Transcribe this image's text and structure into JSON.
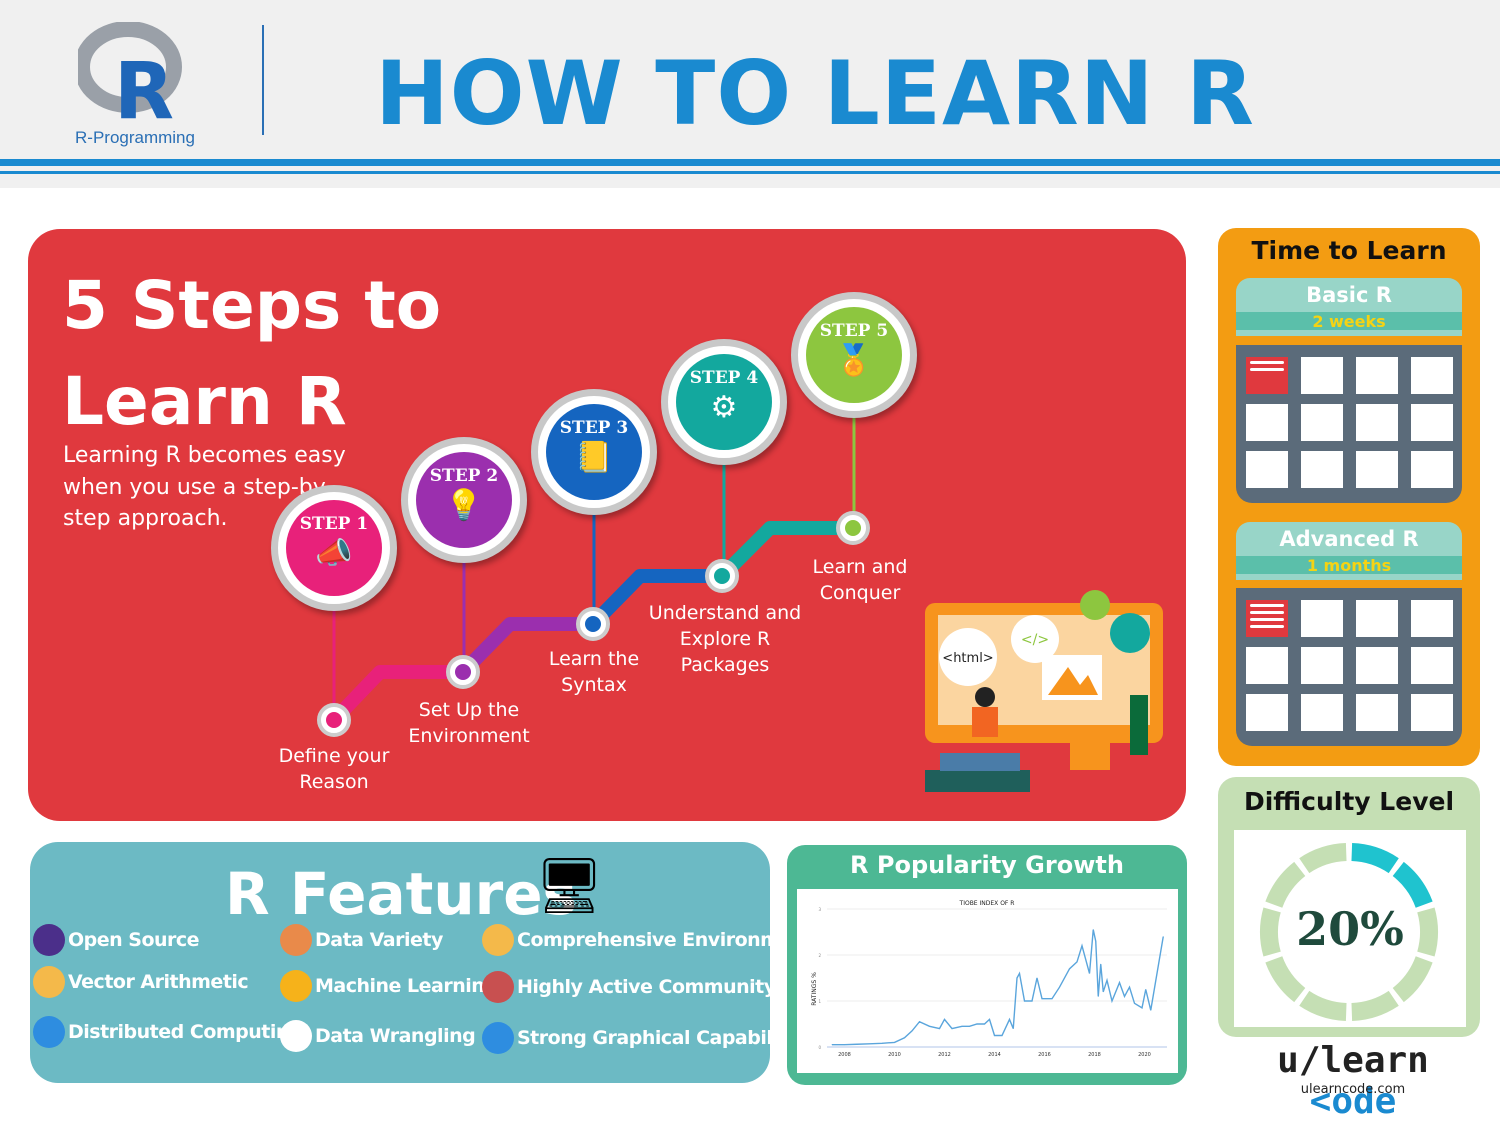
{
  "header": {
    "logo_letter": "R",
    "logo_text": "R-Programming",
    "title": "HOW TO LEARN R"
  },
  "steps_panel": {
    "title": "5 Steps to Learn R",
    "intro": "Learning R becomes easy when you use a step-by-step approach.",
    "steps": [
      {
        "badge": "STEP 1",
        "label": "Define your Reason",
        "color": "#e8217a",
        "icon": "megaphone-person-icon"
      },
      {
        "badge": "STEP 2",
        "label": "Set Up the Environment",
        "color": "#9b2fae",
        "icon": "lightbulb-icon"
      },
      {
        "badge": "STEP 3",
        "label": "Learn the Syntax",
        "color": "#1565c0",
        "icon": "book-icon"
      },
      {
        "badge": "STEP 4",
        "label": "Understand and Explore R Packages",
        "color": "#13a89e",
        "icon": "gear-magnifier-icon"
      },
      {
        "badge": "STEP 5",
        "label": "Learn and Conquer",
        "color": "#8dc63f",
        "icon": "medal-icon"
      }
    ],
    "illustration": {
      "tag1": "<html>",
      "tag2": "</>"
    }
  },
  "time_to_learn": {
    "title": "Time to Learn",
    "items": [
      {
        "name": "Basic R",
        "duration": "2 weeks"
      },
      {
        "name": "Advanced R",
        "duration": "1 months"
      }
    ]
  },
  "difficulty": {
    "title": "Difficulty Level",
    "value_label": "20%",
    "value": 20,
    "colors": {
      "filled": "#1fc3cf",
      "empty": "#c5dfb4"
    }
  },
  "features": {
    "title": "R Features",
    "items": [
      {
        "label": "Open Source",
        "icon": "open-source-icon",
        "color": "#4b2f8a"
      },
      {
        "label": "Data Variety",
        "icon": "data-variety-icon",
        "color": "#e98a4a"
      },
      {
        "label": "Comprehensive Environment",
        "icon": "shield-check-icon",
        "color": "#f4b94a"
      },
      {
        "label": "Vector Arithmetic",
        "icon": "scale-icon",
        "color": "#f4b94a"
      },
      {
        "label": "Machine Learning",
        "icon": "computer-icon",
        "color": "#f6b21a"
      },
      {
        "label": "Highly Active Community",
        "icon": "thumbs-up-icon",
        "color": "#c85050"
      },
      {
        "label": "Distributed Computing",
        "icon": "mobile-icon",
        "color": "#2e8de0"
      },
      {
        "label": "Data Wrangling",
        "icon": "hand-truck-icon",
        "color": "#ffffff"
      },
      {
        "label": "Strong Graphical Capabilities",
        "icon": "bar-chart-icon",
        "color": "#2e8de0"
      }
    ]
  },
  "popularity": {
    "title": "R Popularity Growth"
  },
  "chart_data": {
    "type": "line",
    "title": "TIOBE INDEX OF R",
    "xlabel": "",
    "ylabel": "RATINGS %",
    "xlim": [
      2007.3,
      2020.9
    ],
    "ylim": [
      0,
      3
    ],
    "xticks": [
      "2008",
      "2010",
      "2012",
      "2014",
      "2016",
      "2018",
      "2020"
    ],
    "yticks": [
      "0",
      "1",
      "2",
      "3"
    ],
    "grid": "horizontal",
    "color": "#5aa5dc",
    "x": [
      2007.5,
      2008,
      2008.5,
      2009,
      2009.5,
      2010,
      2010.4,
      2010.7,
      2011,
      2011.4,
      2011.8,
      2012,
      2012.3,
      2012.7,
      2013,
      2013.3,
      2013.6,
      2013.8,
      2014,
      2014.3,
      2014.6,
      2014.75,
      2014.9,
      2015,
      2015.2,
      2015.5,
      2015.7,
      2015.9,
      2016.3,
      2016.6,
      2017,
      2017.3,
      2017.5,
      2017.8,
      2017.95,
      2018.05,
      2018.15,
      2018.25,
      2018.35,
      2018.5,
      2018.7,
      2019,
      2019.2,
      2019.4,
      2019.6,
      2019.9,
      2020.05,
      2020.25,
      2020.5,
      2020.75
    ],
    "y": [
      0.05,
      0.05,
      0.06,
      0.07,
      0.08,
      0.1,
      0.2,
      0.35,
      0.55,
      0.45,
      0.4,
      0.6,
      0.4,
      0.45,
      0.45,
      0.5,
      0.5,
      0.6,
      0.25,
      0.25,
      0.6,
      0.4,
      1.5,
      1.6,
      1.0,
      1.0,
      1.5,
      1.05,
      1.05,
      1.3,
      1.7,
      1.85,
      2.2,
      1.6,
      2.55,
      2.3,
      1.1,
      1.8,
      1.2,
      1.45,
      1.0,
      1.4,
      1.1,
      1.3,
      0.95,
      0.85,
      1.25,
      0.8,
      1.6,
      2.4
    ]
  },
  "footer": {
    "brand": "u/learn ",
    "brand_accent": "<ode",
    "url": "ulearncode.com"
  }
}
